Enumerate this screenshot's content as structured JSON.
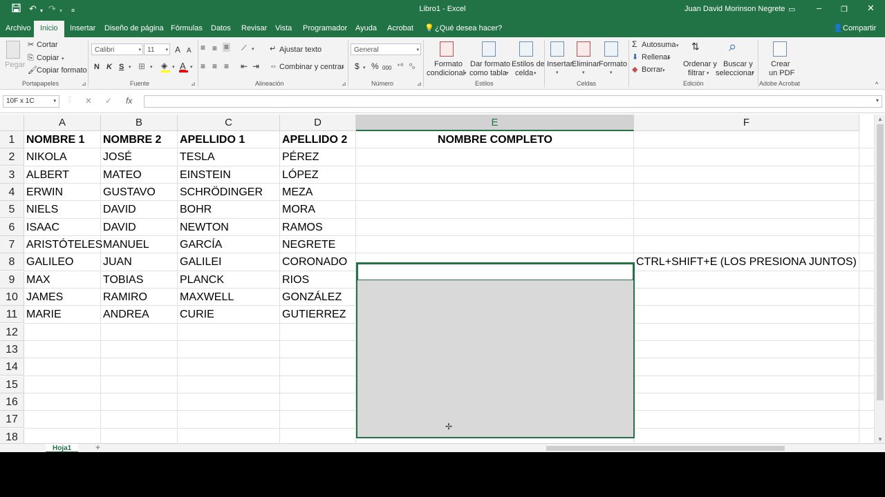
{
  "window": {
    "title": "Libro1 - Excel",
    "user": "Juan David Morinson Negrete",
    "quick_access": {
      "save": "save-icon",
      "undo": "undo-icon",
      "redo": "redo-icon",
      "customize": "customize-icon"
    },
    "controls": {
      "restore": "ribbon-display-icon",
      "minimize": "minimize-icon",
      "maximize": "maximize-icon",
      "close": "close-icon"
    }
  },
  "menu": {
    "tabs": [
      "Archivo",
      "Inicio",
      "Insertar",
      "Diseño de página",
      "Fórmulas",
      "Datos",
      "Revisar",
      "Vista",
      "Programador",
      "Ayuda",
      "Acrobat"
    ],
    "active": "Inicio",
    "tell_me": "¿Qué desea hacer?",
    "share": "Compartir"
  },
  "ribbon": {
    "clipboard": {
      "paste": "Pegar",
      "cut": "Cortar",
      "copy": "Copiar",
      "format_painter": "Copiar formato",
      "label": "Portapapeles"
    },
    "font": {
      "name": "Calibri",
      "size": "11",
      "bold": "N",
      "italic": "K",
      "underline": "S",
      "increase": "A",
      "decrease": "A",
      "label": "Fuente",
      "accent_color": "#ff0000",
      "highlight_color": "#ffff00"
    },
    "alignment": {
      "wrap": "Ajustar texto",
      "merge": "Combinar y centrar",
      "label": "Alineación"
    },
    "number": {
      "format": "General",
      "currency": "$",
      "percent": "%",
      "thousands": "000",
      "label": "Número"
    },
    "styles": {
      "conditional": [
        "Formato",
        "condicional"
      ],
      "table": [
        "Dar formato",
        "como tabla"
      ],
      "cell": [
        "Estilos de",
        "celda"
      ],
      "label": "Estilos"
    },
    "cells": {
      "insert": "Insertar",
      "delete": "Eliminar",
      "format": "Formato",
      "label": "Celdas"
    },
    "editing": {
      "autosum": "Autosuma",
      "fill": "Rellenar",
      "clear": "Borrar",
      "sort": [
        "Ordenar y",
        "filtrar"
      ],
      "find": [
        "Buscar y",
        "seleccionar"
      ],
      "label": "Edición"
    },
    "acrobat": {
      "create": [
        "Crear",
        "un PDF"
      ],
      "label": "Adobe Acrobat"
    }
  },
  "formula_bar": {
    "name_box": "10F x 1C",
    "cancel": "✕",
    "enter": "✓",
    "fx": "fx",
    "value": ""
  },
  "sheet": {
    "columns": [
      "A",
      "B",
      "C",
      "D",
      "E",
      "F"
    ],
    "selected_column": "E",
    "rows": [
      [
        "NOMBRE 1",
        "NOMBRE 2",
        "APELLIDO 1",
        "APELLIDO 2",
        "NOMBRE COMPLETO",
        ""
      ],
      [
        "NIKOLA",
        "JOSÉ",
        "TESLA",
        "PÉREZ",
        "",
        ""
      ],
      [
        "ALBERT",
        "MATEO",
        "EINSTEIN",
        "LÓPEZ",
        "",
        ""
      ],
      [
        "ERWIN",
        "GUSTAVO",
        "SCHRÖDINGER",
        "MEZA",
        "",
        ""
      ],
      [
        "NIELS",
        "DAVID",
        "BOHR",
        "MORA",
        "",
        ""
      ],
      [
        "ISAAC",
        "DAVID",
        "NEWTON",
        "RAMOS",
        "",
        ""
      ],
      [
        "ARISTÓTELES",
        "MANUEL",
        "GARCÍA",
        "NEGRETE",
        "",
        ""
      ],
      [
        "GALILEO",
        "JUAN",
        "GALILEI",
        "CORONADO",
        "",
        "CTRL+SHIFT+E (LOS PRESIONA JUNTOS)"
      ],
      [
        "MAX",
        "TOBIAS",
        "PLANCK",
        "RIOS",
        "",
        ""
      ],
      [
        "JAMES",
        "RAMIRO",
        "MAXWELL",
        "GONZÁLEZ",
        "",
        ""
      ],
      [
        "MARIE",
        "ANDREA",
        "CURIE",
        "GUTIERREZ",
        "",
        ""
      ]
    ],
    "row_numbers": [
      "1",
      "2",
      "3",
      "4",
      "5",
      "6",
      "7",
      "8",
      "9",
      "10",
      "11",
      "12",
      "13",
      "14",
      "15",
      "16",
      "17",
      "18"
    ],
    "accent": "#217346"
  },
  "sheet_tabs": {
    "active": "Hoja1",
    "add": "+"
  }
}
